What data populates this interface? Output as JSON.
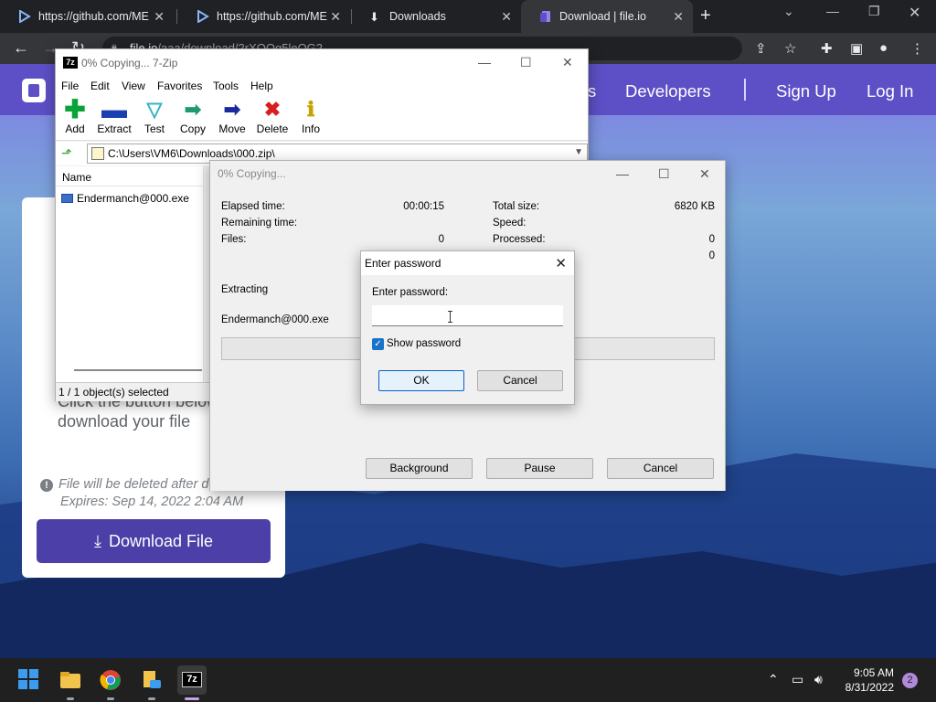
{
  "browser": {
    "tabs": [
      {
        "label": "https://github.com/ME",
        "active": false
      },
      {
        "label": "https://github.com/ME",
        "active": false
      },
      {
        "label": "Downloads",
        "active": false
      },
      {
        "label": "Download | file.io",
        "active": true
      }
    ],
    "url_host": "file.io",
    "url_path": "/aaa/download/2rXOQg5leQG2"
  },
  "website": {
    "nav": {
      "items": [
        "s",
        "Developers",
        "Sign Up",
        "Log In"
      ]
    },
    "card": {
      "instruction": "Click the button below to download your file",
      "note": "File will be deleted after download",
      "expires": "Expires: Sep 14, 2022 2:04 AM",
      "download_label": "Download File"
    }
  },
  "zip": {
    "title": "0% Copying... 7-Zip",
    "app_icon": "7z",
    "menu": [
      "File",
      "Edit",
      "View",
      "Favorites",
      "Tools",
      "Help"
    ],
    "toolbar": [
      {
        "label": "Add",
        "icon": "plus-icon",
        "color": "#0aa33a"
      },
      {
        "label": "Extract",
        "icon": "minus-icon",
        "color": "#1a3fb0"
      },
      {
        "label": "Test",
        "icon": "check-icon",
        "color": "#33b5c4"
      },
      {
        "label": "Copy",
        "icon": "arrow-right-icon",
        "color": "#1e9a6c"
      },
      {
        "label": "Move",
        "icon": "arrow-right-icon",
        "color": "#1a2a9e"
      },
      {
        "label": "Delete",
        "icon": "x-icon",
        "color": "#d81e1e"
      },
      {
        "label": "Info",
        "icon": "info-icon",
        "color": "#c8a200"
      }
    ],
    "path": "C:\\Users\\VM6\\Downloads\\000.zip\\",
    "column_name": "Name",
    "files": [
      "Endermanch@000.exe"
    ],
    "status": "1 / 1 object(s) selected"
  },
  "progress": {
    "title": "0% Copying...",
    "left": [
      {
        "label": "Elapsed time:",
        "value": "00:00:15"
      },
      {
        "label": "Remaining time:",
        "value": ""
      },
      {
        "label": "Files:",
        "value": "0"
      }
    ],
    "right": [
      {
        "label": "Total size:",
        "value": "6820 KB"
      },
      {
        "label": "Speed:",
        "value": ""
      },
      {
        "label": "Processed:",
        "value": "0"
      },
      {
        "label": "",
        "value": "0"
      }
    ],
    "operation": "Extracting",
    "current_file": "Endermanch@000.exe",
    "progress_fraction": 0,
    "buttons": {
      "background": "Background",
      "pause": "Pause",
      "cancel": "Cancel"
    }
  },
  "password": {
    "title": "Enter password",
    "label": "Enter password:",
    "value": "",
    "show_label": "Show password",
    "show_checked": true,
    "ok": "OK",
    "cancel": "Cancel"
  },
  "taskbar": {
    "time": "9:05 AM",
    "date": "8/31/2022",
    "notifications": "2"
  }
}
